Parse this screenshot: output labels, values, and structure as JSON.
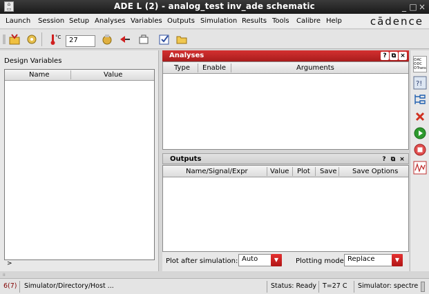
{
  "window": {
    "title": "ADE L (2) - analog_test inv_ade schematic",
    "minimize_glyph": "_",
    "maximize_glyph": "□",
    "close_glyph": "×"
  },
  "menu": {
    "items": [
      "Launch",
      "Session",
      "Setup",
      "Analyses",
      "Variables",
      "Outputs",
      "Simulation",
      "Results",
      "Tools",
      "Calibre",
      "Help"
    ],
    "brand": "cādence"
  },
  "toolbar": {
    "temperature_value": "27",
    "icons": [
      "launch-icon",
      "open-icon",
      "thermometer-icon",
      "design-icon",
      "select-on-schematic-icon",
      "library-icon",
      "checklist-icon",
      "folder-icon"
    ]
  },
  "design_variables": {
    "label": "Design Variables",
    "columns": [
      "Name",
      "Value"
    ],
    "expander_glyph": ">"
  },
  "analyses": {
    "title": "Analyses",
    "columns": [
      "Type",
      "Enable",
      "Arguments"
    ],
    "tools": [
      "?",
      "⧉",
      "×"
    ]
  },
  "outputs": {
    "title": "Outputs",
    "columns": [
      "Name/Signal/Expr",
      "Value",
      "Plot",
      "Save",
      "Save Options"
    ],
    "tools": [
      "?",
      "⧉",
      "×"
    ]
  },
  "plot_controls": {
    "plot_after_label": "Plot after simulation:",
    "plot_after_value": "Auto",
    "plotting_mode_label": "Plotting mode:",
    "plotting_mode_value": "Replace"
  },
  "right_toolbar": {
    "analysis_types": [
      "AC",
      "DC",
      "Trans"
    ],
    "icons": [
      "choose-analysis-icon",
      "variable-icon",
      "netlist-icon",
      "delete-icon",
      "run-icon",
      "stop-icon",
      "plot-outputs-icon"
    ]
  },
  "status": {
    "count": "6(7)",
    "path": "Simulator/Directory/Host ...",
    "state": "Status: Ready",
    "temp": "T=27  C",
    "simulator": "Simulator: spectre"
  },
  "colors": {
    "analyses_header": "#c02222",
    "combo_arrow": "#d42020",
    "run_green": "#2e9a2e",
    "stop_red": "#d43030"
  }
}
